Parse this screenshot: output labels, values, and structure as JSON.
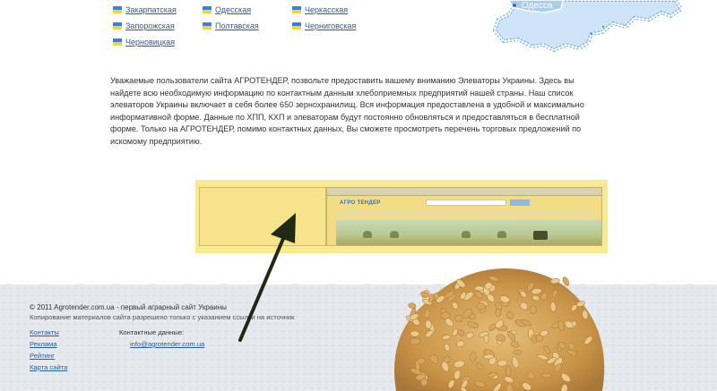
{
  "regions": [
    {
      "label": "Закарпатская"
    },
    {
      "label": "Одесская"
    },
    {
      "label": "Черкасская"
    },
    {
      "label": "Запорожская"
    },
    {
      "label": "Полтавская"
    },
    {
      "label": "Черниговская"
    },
    {
      "label": "Черновицкая"
    }
  ],
  "map": {
    "city_label": "Одесса",
    "sea_color": "#ffffff",
    "land_color": "#cfe4f7",
    "border_color": "#6aaee6"
  },
  "intro_text": "Уважаемые пользователи сайта АГРОТЕНДЕР, позвольте предоставить вашему вниманию Элеваторы Украины. Здесь вы найдете всю необходимую информацию по контактным данным хлебоприемных предприятий нашей страны.  Наш список элеваторов Украины включает в себя более 650 зернохранилищ.  Вся информация предоставлена в удобной и максимально информативной форме.  Данные по ХПП, КХП и элеваторам будут постоянно обновляться и предоставляться в бесплатной форме. Только на АГРОТЕНДЕР, помимо контактных данных, Вы сможете просмотреть перечень торговых предложений по искомому предприятию.",
  "promo": {
    "shot_logo": "АГРО ТЕНДЕР",
    "highlight_color": "#fbe98f"
  },
  "footer": {
    "copyright": "© 2011 Agrotender.com.ua - первый аграрный сайт Украины",
    "copy_notice": "Копирование материалов сайта разрешено только с указанием ссылки на источник",
    "links": [
      "Контакты",
      "Реклама",
      "Рейтинг",
      "Карта сайта"
    ],
    "contact_label": "Контактные данные:",
    "contact_email": "info@agrotender.com.ua"
  }
}
